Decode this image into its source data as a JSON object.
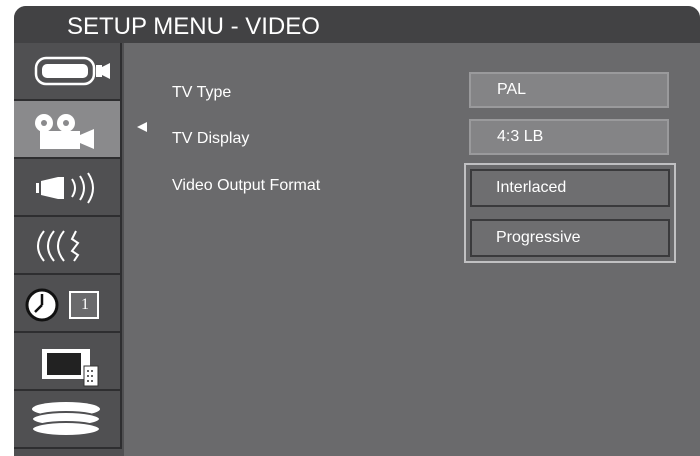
{
  "header": {
    "title": "SETUP MENU - VIDEO"
  },
  "sidebar": {
    "items": [
      {
        "icon": "camcorder-icon",
        "selected": false
      },
      {
        "icon": "video-camera-icon",
        "selected": true
      },
      {
        "icon": "speaker-icon",
        "selected": false
      },
      {
        "icon": "subtitle-waves-icon",
        "selected": false
      },
      {
        "icon": "clock-icon",
        "badge": "1",
        "selected": false
      },
      {
        "icon": "tv-remote-icon",
        "selected": false
      },
      {
        "icon": "disc-stack-icon",
        "selected": false
      }
    ]
  },
  "settings": {
    "tv_type": {
      "label": "TV Type",
      "value": "PAL"
    },
    "tv_display": {
      "label": "TV Display",
      "value": "4:3 LB"
    },
    "video_output_format": {
      "label": "Video Output Format",
      "options": [
        "Interlaced",
        "Progressive"
      ],
      "highlighted": "Interlaced"
    }
  }
}
